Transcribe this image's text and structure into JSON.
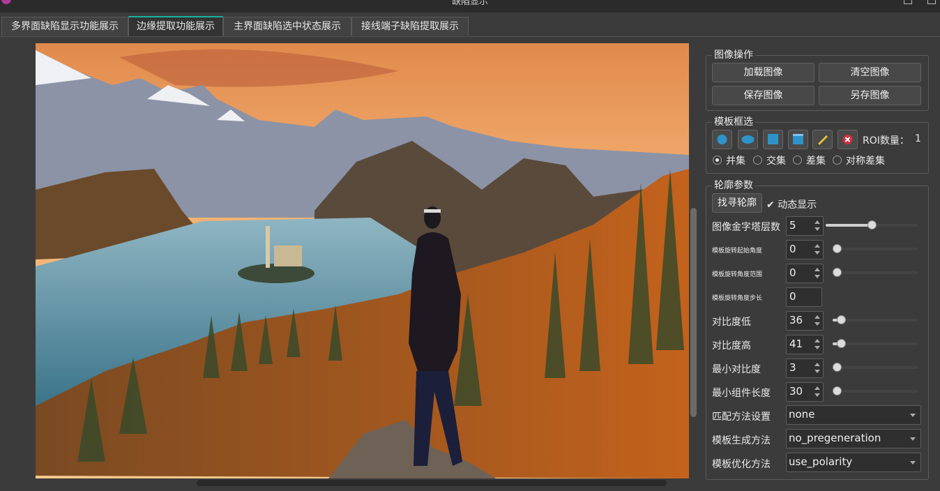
{
  "window": {
    "title": "缺陷显示"
  },
  "tabs": [
    {
      "label": "多界面缺陷显示功能展示"
    },
    {
      "label": "边缘提取功能展示"
    },
    {
      "label": "主界面缺陷选中状态展示"
    },
    {
      "label": "接线端子缺陷提取展示"
    }
  ],
  "image_ops": {
    "title": "图像操作",
    "load": "加载图像",
    "clear": "清空图像",
    "save": "保存图像",
    "save_as": "另存图像"
  },
  "template_select": {
    "title": "模板框选",
    "roi_label": "ROI数量：",
    "roi_count": "1",
    "tool_icons": [
      "circle-icon",
      "ellipse-icon",
      "rectangle-icon",
      "rotated-rectangle-icon",
      "brush-icon",
      "delete-icon"
    ],
    "modes": [
      "并集",
      "交集",
      "差集",
      "对称差集"
    ],
    "selected_mode": "并集"
  },
  "contour": {
    "title": "轮廓参数",
    "find_button": "找寻轮廓",
    "dynamic_display": "动态显示",
    "dynamic_checked": true,
    "params": [
      {
        "label": "图像金字塔层数",
        "value": "5",
        "level": 0.5
      },
      {
        "label": "模板旋转起始角度",
        "value": "0",
        "level": 0.0
      },
      {
        "label": "模板旋转角度范围",
        "value": "0",
        "level": 0.0
      },
      {
        "label": "模板旋转角度步长",
        "value": "0"
      },
      {
        "label": "对比度低",
        "value": "36",
        "level": 0.1
      },
      {
        "label": "对比度高",
        "value": "41",
        "level": 0.1
      },
      {
        "label": "最小对比度",
        "value": "3",
        "level": 0.02
      },
      {
        "label": "最小组件长度",
        "value": "30",
        "level": 0.05
      }
    ],
    "match_method": {
      "label": "匹配方法设置",
      "value": "none"
    },
    "gen_method": {
      "label": "模板生成方法",
      "value": "no_pregeneration"
    },
    "opt_method": {
      "label": "模板优化方法",
      "value": "use_polarity"
    }
  },
  "colors": {
    "accent_tab": "#19b3a3",
    "tool_blue": "#2e93c9",
    "delete_red": "#d03040"
  }
}
